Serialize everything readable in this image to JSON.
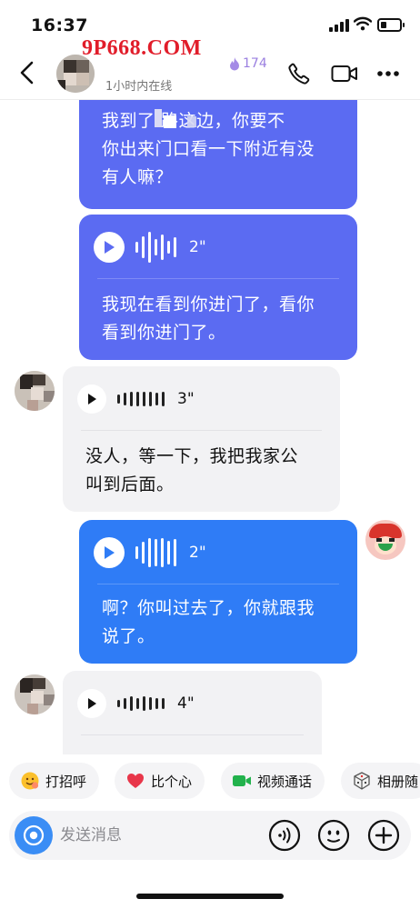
{
  "status_bar": {
    "time": "16:37",
    "battery_level": 0.3
  },
  "watermark": {
    "text": "9P668.COM"
  },
  "header": {
    "back_icon": "chevron-left-icon",
    "contact_name": "",
    "fire_icon": "flame-icon",
    "fire_count": "174",
    "online_status": "1小时内在线",
    "actions": [
      "phone-icon",
      "video-icon",
      "more-icon"
    ]
  },
  "messages": [
    {
      "type": "text",
      "direction": "out",
      "text": [
        "我到了 路这边，你要不",
        "你出来门口看一下附近有没",
        "有人嘛？"
      ]
    },
    {
      "type": "voice",
      "direction": "out",
      "duration": "2\"",
      "transcript": [
        "我现在看到你进门了，看你",
        "看到你进门了。"
      ]
    },
    {
      "type": "voice",
      "direction": "in",
      "duration": "3\"",
      "transcript": [
        "没人，等一下，我把我家公",
        "叫到后面。"
      ]
    },
    {
      "type": "voice",
      "direction": "out",
      "duration": "2\"",
      "transcript": [
        "啊？你叫过去了，你就跟我",
        "说了。"
      ]
    },
    {
      "type": "voice",
      "direction": "in",
      "duration": "4\"",
      "transcript": []
    }
  ],
  "quick_replies": [
    {
      "icon": "wave-emoji-icon",
      "label": "打招呼"
    },
    {
      "icon": "heart-icon",
      "label": "比个心"
    },
    {
      "icon": "video-call-icon",
      "label": "视频通话"
    },
    {
      "icon": "dice-icon",
      "label": "相册随"
    }
  ],
  "input": {
    "placeholder": "发送消息"
  },
  "colors": {
    "outgoing": "#5b6bf2",
    "outgoing_blue": "#2f7cf6",
    "incoming": "#f2f2f4",
    "accent": "#3a8df5"
  }
}
